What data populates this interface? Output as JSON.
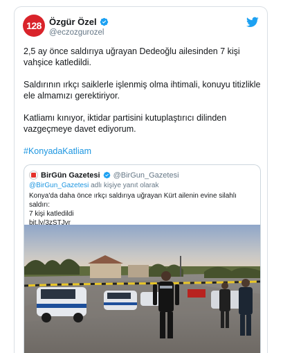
{
  "tweet": {
    "avatar_text": "128",
    "display_name": "Özgür Özel",
    "handle": "@eczozgurozel",
    "paragraphs": [
      "2,5 ay önce saldırıya uğrayan Dedeoğlu ailesinden 7 kişi vahşice katledildi.",
      "Saldırının ırkçı saiklerle işlenmiş olma ihtimali, konuyu titizlikle ele almamızı gerektiriyor.",
      "Katliamı kınıyor, iktidar partisini kutuplaştırıcı dilinden vazgeçmeye davet ediyorum."
    ],
    "hashtag": "#KonyadaKatliam"
  },
  "quote": {
    "display_name": "BirGün Gazetesi",
    "handle": "@BirGun_Gazetesi",
    "reply_mention": "@BirGun_Gazetesi",
    "reply_suffix": " adlı kişiye yanıt olarak",
    "text_line1": "Konya'da daha önce ırkçı saldırıya uğrayan Kürt ailenin evine silahlı saldırı:",
    "text_line2": "7 kişi katledildi",
    "link": "bit.ly/3zSTJvr"
  },
  "colors": {
    "link_blue": "#1b95e0",
    "verified_blue": "#1da1f2",
    "avatar_red": "#d9232a"
  },
  "icons": {
    "verified": "verified-badge-icon",
    "brand": "twitter-bird-icon"
  }
}
